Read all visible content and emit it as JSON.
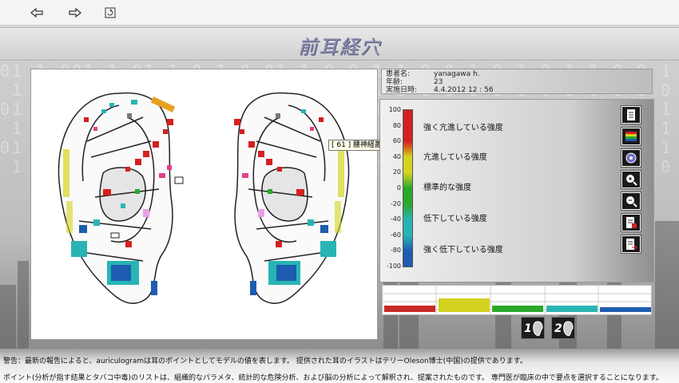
{
  "toolbar": {
    "back_icon": "arrow-left-icon",
    "forward_icon": "arrow-right-icon",
    "refresh_icon": "refresh-icon"
  },
  "header": {
    "title": "前耳経穴"
  },
  "patient": {
    "name_label": "患者名:",
    "name": "yanagawa h.",
    "age_label": "年齢:",
    "age": "23",
    "date_label": "実施日時:",
    "date": "4.4.2012  12 : 56"
  },
  "tooltip": "[ 61 ] 腰神経叢",
  "scale": {
    "ticks": [
      "100",
      "80",
      "60",
      "40",
      "20",
      "0",
      "-20",
      "-40",
      "-60",
      "-80",
      "-100"
    ],
    "colors": [
      "#d42020",
      "#d4d420",
      "#2aa82a",
      "#28b4b4",
      "#1d5cb0"
    ]
  },
  "legend": [
    "強く亢進している強度",
    "亢進している強度",
    "標準的な強度",
    "低下している強度",
    "強く低下している強度"
  ],
  "side_buttons": [
    "document-icon",
    "palette-icon",
    "target-icon",
    "zoom-in-icon",
    "zoom-out-icon",
    "report-icon",
    "report-arrow-icon"
  ],
  "bars": [
    {
      "color": "#c82828",
      "level": 0.3
    },
    {
      "color": "#d4d020",
      "level": 0.6
    },
    {
      "color": "#2aa82a",
      "level": 0.3
    },
    {
      "color": "#2ab4b4",
      "level": 0.3
    },
    {
      "color": "#1d5cb0",
      "level": 0.2
    }
  ],
  "ear_buttons": [
    "1",
    "2"
  ],
  "warnings": {
    "line1": "警告：最新の報告によると、auriculogramは耳のポイントとしてモデルの値を表します。 提供された耳のイラストはテリーOleson博士(中国)の提供であります。",
    "line2": "ポイント(分析が指す結果とタバコ中毒)のリストは、組織的なパラメタ、統計的な危険分析、および脳の分析によって解釈され、提案されたものです。 専門医が臨床の中で要点を選択することになります。"
  }
}
